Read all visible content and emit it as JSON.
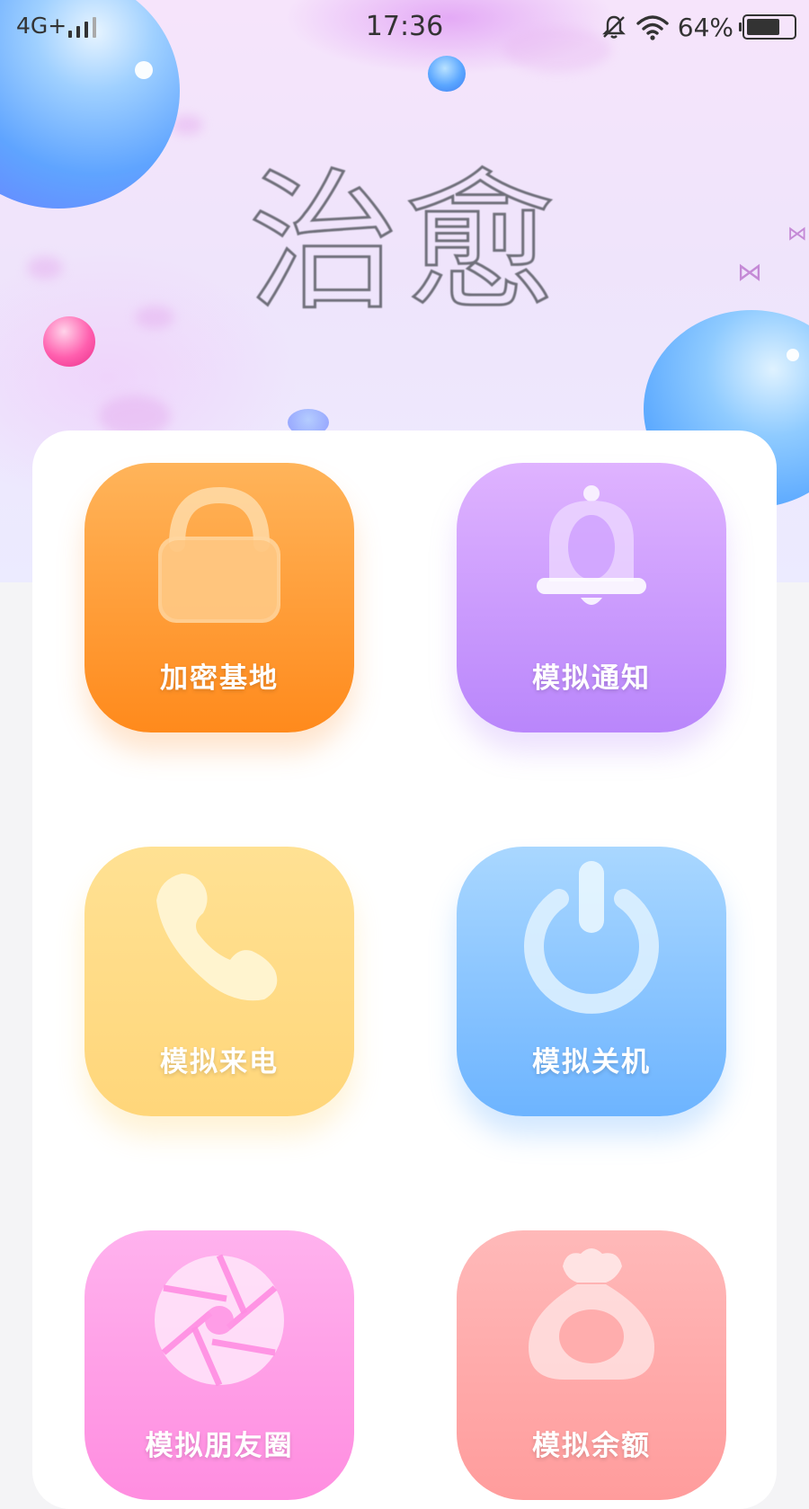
{
  "status_bar": {
    "network": "4G+",
    "time": "17:36",
    "battery_percent": "64%",
    "battery_level": 0.64
  },
  "header": {
    "title": "治愈"
  },
  "tiles": [
    {
      "label": "加密基地",
      "icon": "lock-icon",
      "color": "#ff9a33"
    },
    {
      "label": "模拟通知",
      "icon": "bell-icon",
      "color": "#c99bfd"
    },
    {
      "label": "模拟来电",
      "icon": "phone-icon",
      "color": "#ffdc85"
    },
    {
      "label": "模拟关机",
      "icon": "power-icon",
      "color": "#86c3ff"
    },
    {
      "label": "模拟朋友圈",
      "icon": "aperture-icon",
      "color": "#ff9fe6"
    },
    {
      "label": "模拟余额",
      "icon": "money-bag-icon",
      "color": "#ffa9a9"
    }
  ]
}
